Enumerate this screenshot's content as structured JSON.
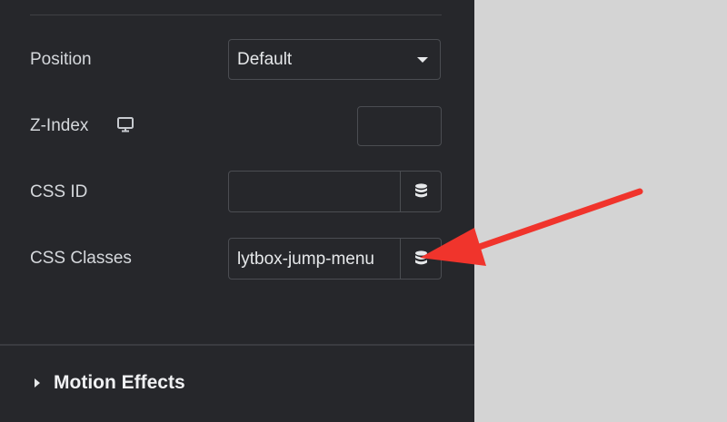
{
  "fields": {
    "position": {
      "label": "Position",
      "value": "Default"
    },
    "z_index": {
      "label": "Z-Index",
      "device_icon": "desktop-icon",
      "value": ""
    },
    "css_id": {
      "label": "CSS ID",
      "value": "",
      "dynamic_icon": "database-icon"
    },
    "css_classes": {
      "label": "CSS Classes",
      "value": "lytbox-jump-menu",
      "dynamic_icon": "database-icon"
    }
  },
  "section": {
    "title": "Motion Effects",
    "expand_icon": "caret-right-icon"
  },
  "annotation": {
    "type": "arrow",
    "color": "#f0342c",
    "points_to": "css-classes-dynamic-button"
  },
  "colors": {
    "panel": "#26272b",
    "canvas": "#d4d4d4",
    "border": "#4b4d52",
    "text": "#d5d8dc"
  }
}
